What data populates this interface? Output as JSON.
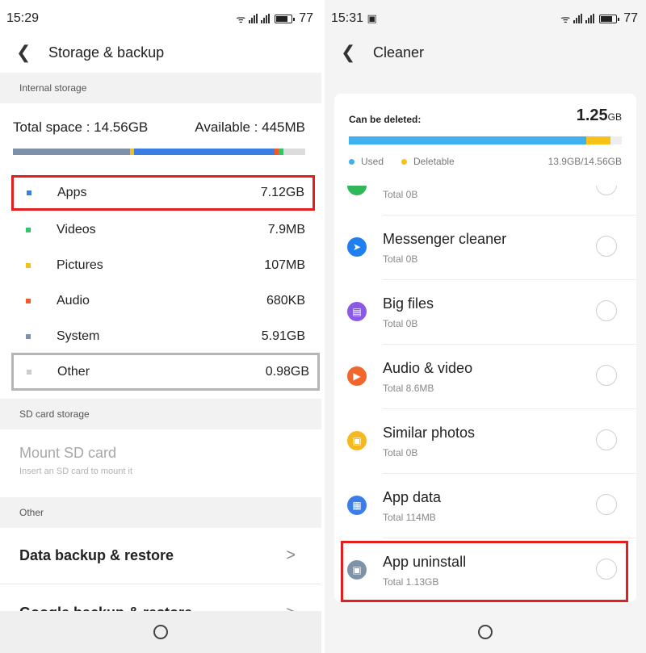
{
  "left": {
    "status": {
      "time": "15:29",
      "battery": "77"
    },
    "title": "Storage & backup",
    "internal_label": "Internal storage",
    "total_space": "Total space : 14.56GB",
    "available": "Available : 445MB",
    "categories": [
      {
        "name": "Apps",
        "value": "7.12GB",
        "color": "#3b7de0"
      },
      {
        "name": "Videos",
        "value": "7.9MB",
        "color": "#35c26a"
      },
      {
        "name": "Pictures",
        "value": "107MB",
        "color": "#f5c01b"
      },
      {
        "name": "Audio",
        "value": "680KB",
        "color": "#f15a2b"
      },
      {
        "name": "System",
        "value": "5.91GB",
        "color": "#7f90a8"
      },
      {
        "name": "Other",
        "value": "0.98GB",
        "color": "#cccccc"
      }
    ],
    "sd_label": "SD card storage",
    "mount_title": "Mount SD card",
    "mount_sub": "Insert an SD card to mount it",
    "other_label": "Other",
    "menu": [
      "Data backup & restore",
      "Google backup & restore"
    ]
  },
  "right": {
    "status": {
      "time": "15:31",
      "battery": "77"
    },
    "title": "Cleaner",
    "can_delete_label": "Can be deleted:",
    "can_delete_value": "1.25",
    "can_delete_unit": "GB",
    "used_label": "Used",
    "deletable_label": "Deletable",
    "ratio": "13.9GB/14.56GB",
    "items": [
      {
        "title": "",
        "sub": "Total 0B",
        "icon": "whatsapp-cleaner-icon",
        "color": "#2fb85a"
      },
      {
        "title": "Messenger cleaner",
        "sub": "Total 0B",
        "icon": "messenger-icon",
        "color": "#1f7ff0"
      },
      {
        "title": "Big files",
        "sub": "Total 0B",
        "icon": "file-icon",
        "color": "#8a5ae6"
      },
      {
        "title": "Audio & video",
        "sub": "Total 8.6MB",
        "icon": "play-icon",
        "color": "#f2662b"
      },
      {
        "title": "Similar photos",
        "sub": "Total 0B",
        "icon": "photo-icon",
        "color": "#f5b81f"
      },
      {
        "title": "App data",
        "sub": "Total 114MB",
        "icon": "grid-icon",
        "color": "#3c7ee8"
      },
      {
        "title": "App uninstall",
        "sub": "Total 1.13GB",
        "icon": "trash-icon",
        "color": "#7f93a8"
      }
    ]
  }
}
